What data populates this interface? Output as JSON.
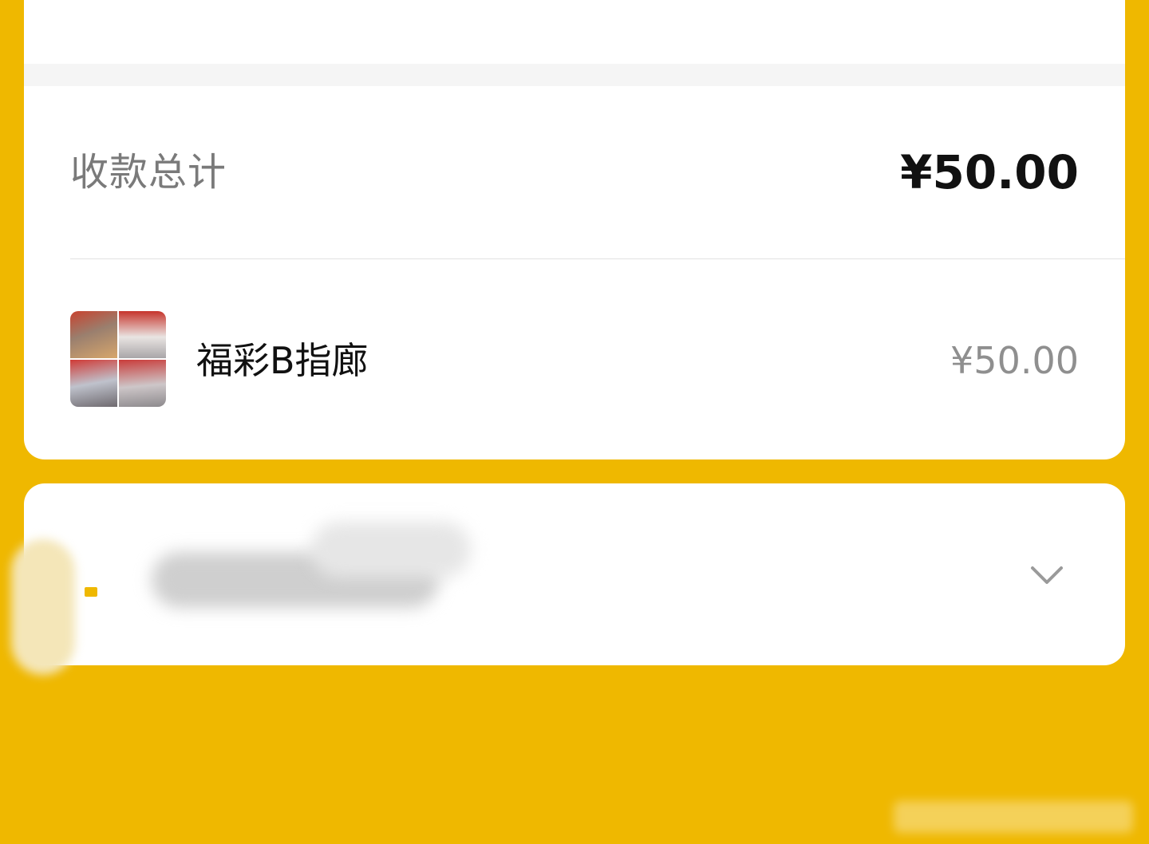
{
  "summary": {
    "total_label": "收款总计",
    "total_amount": "¥50.00"
  },
  "merchant": {
    "name": "福彩B指廊",
    "amount": "¥50.00",
    "thumbnail_icon": "store-photo-thumbnail"
  },
  "details_card": {
    "expand_icon": "chevron-down-icon"
  },
  "colors": {
    "background": "#EFB800",
    "card": "#FFFFFF",
    "label_gray": "#7A7A7A",
    "amount_dark": "#111111",
    "amount_gray": "#8F8F8F"
  }
}
